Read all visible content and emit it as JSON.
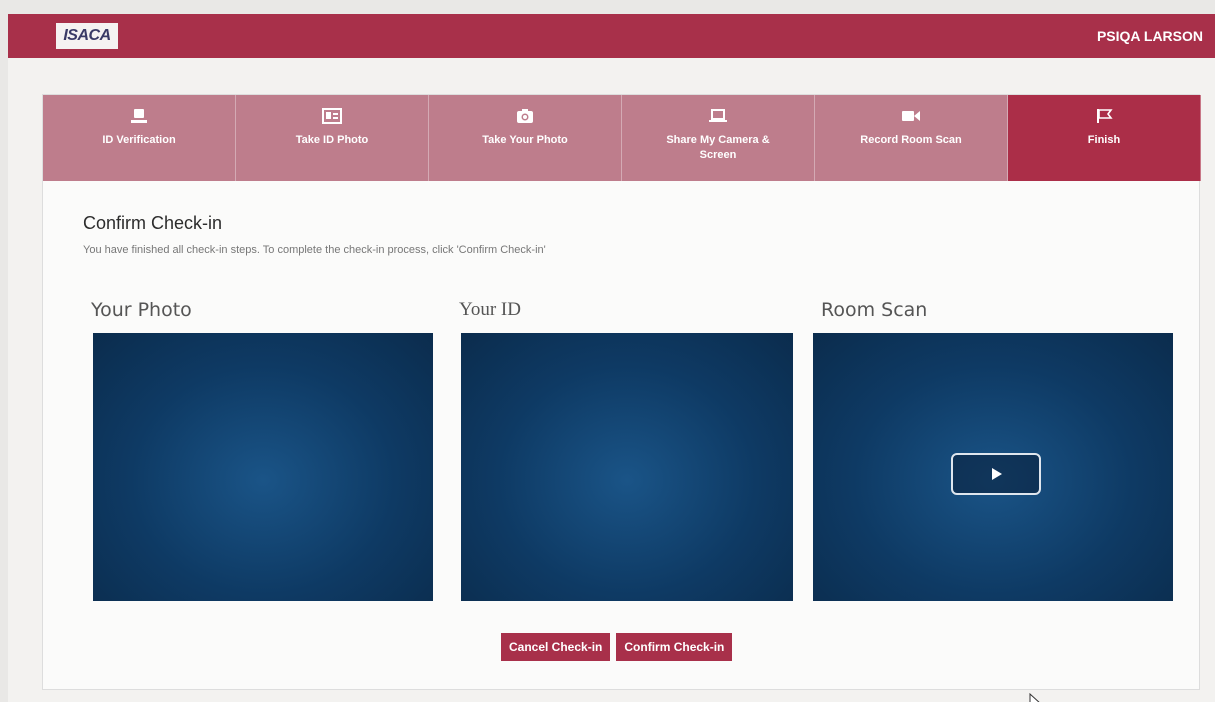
{
  "header": {
    "logo_text": "ISACA",
    "user_name": "PSIQA LARSON"
  },
  "steps": [
    {
      "label": "ID Verification",
      "icon": "id-verification-icon"
    },
    {
      "label": "Take ID Photo",
      "icon": "id-card-icon"
    },
    {
      "label": "Take Your Photo",
      "icon": "camera-icon"
    },
    {
      "label": "Share My Camera & Screen",
      "icon": "laptop-icon"
    },
    {
      "label": "Record Room Scan",
      "icon": "video-camera-icon"
    },
    {
      "label": "Finish",
      "icon": "finish-flag-icon",
      "active": true
    }
  ],
  "main": {
    "title": "Confirm Check-in",
    "subtitle": "You have finished all check-in steps. To complete the check-in process, click 'Confirm Check-in'",
    "media": [
      {
        "label": "Your Photo"
      },
      {
        "label": "Your ID"
      },
      {
        "label": "Room Scan",
        "has_play": true
      }
    ]
  },
  "actions": {
    "cancel_label": "Cancel Check-in",
    "confirm_label": "Confirm Check-in"
  },
  "colors": {
    "brand": "#a8304a",
    "step_inactive": "#be7d8c",
    "media_bg": "#0e3a64"
  }
}
